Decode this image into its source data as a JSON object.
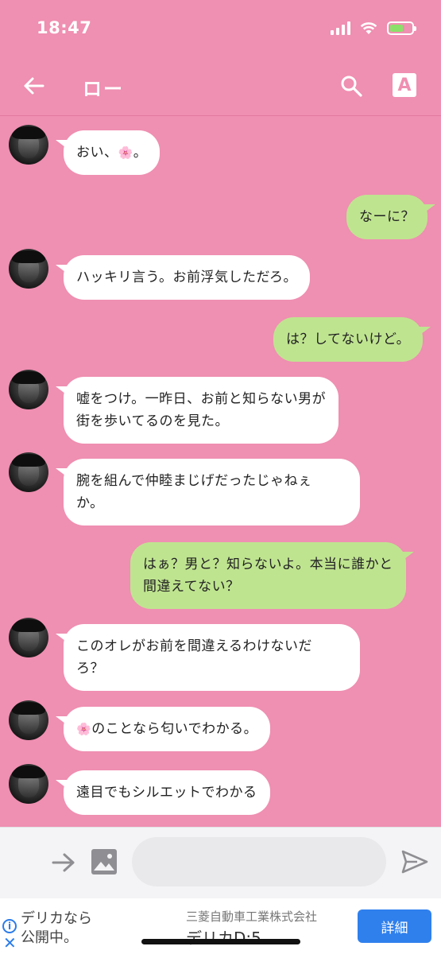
{
  "status": {
    "time": "18:47"
  },
  "header": {
    "title": "ロー",
    "font_button_label": "A"
  },
  "messages": [
    {
      "side": "left",
      "text": "おい、🌸。"
    },
    {
      "side": "right",
      "text": "なーに？"
    },
    {
      "side": "left",
      "text": "ハッキリ言う。お前浮気しただろ。"
    },
    {
      "side": "right",
      "text": "は？してないけど。"
    },
    {
      "side": "left",
      "text": "嘘をつけ。一昨日、お前と知らない男が\n街を歩いてるのを見た。"
    },
    {
      "side": "left",
      "text": "腕を組んで仲睦まじげだったじゃねぇ\nか。"
    },
    {
      "side": "right",
      "text": "はぁ？男と？知らないよ。本当に誰かと\n間違えてない？"
    },
    {
      "side": "left",
      "text": "このオレがお前を間違えるわけないだ\nろ？"
    },
    {
      "side": "left",
      "text": "🌸のことなら匂いでわかる。"
    },
    {
      "side": "left",
      "text": "遠目でもシルエットでわかる"
    }
  ],
  "ad": {
    "left_text": "デリカなら\n公開中。",
    "company": "三菱自動車工業株式会社",
    "product": "デリカD:5",
    "cta": "詳細"
  },
  "colors": {
    "background": "#ef8fb1",
    "bubble_left": "#ffffff",
    "bubble_right": "#bfe490",
    "accent": "#2f80ed"
  }
}
